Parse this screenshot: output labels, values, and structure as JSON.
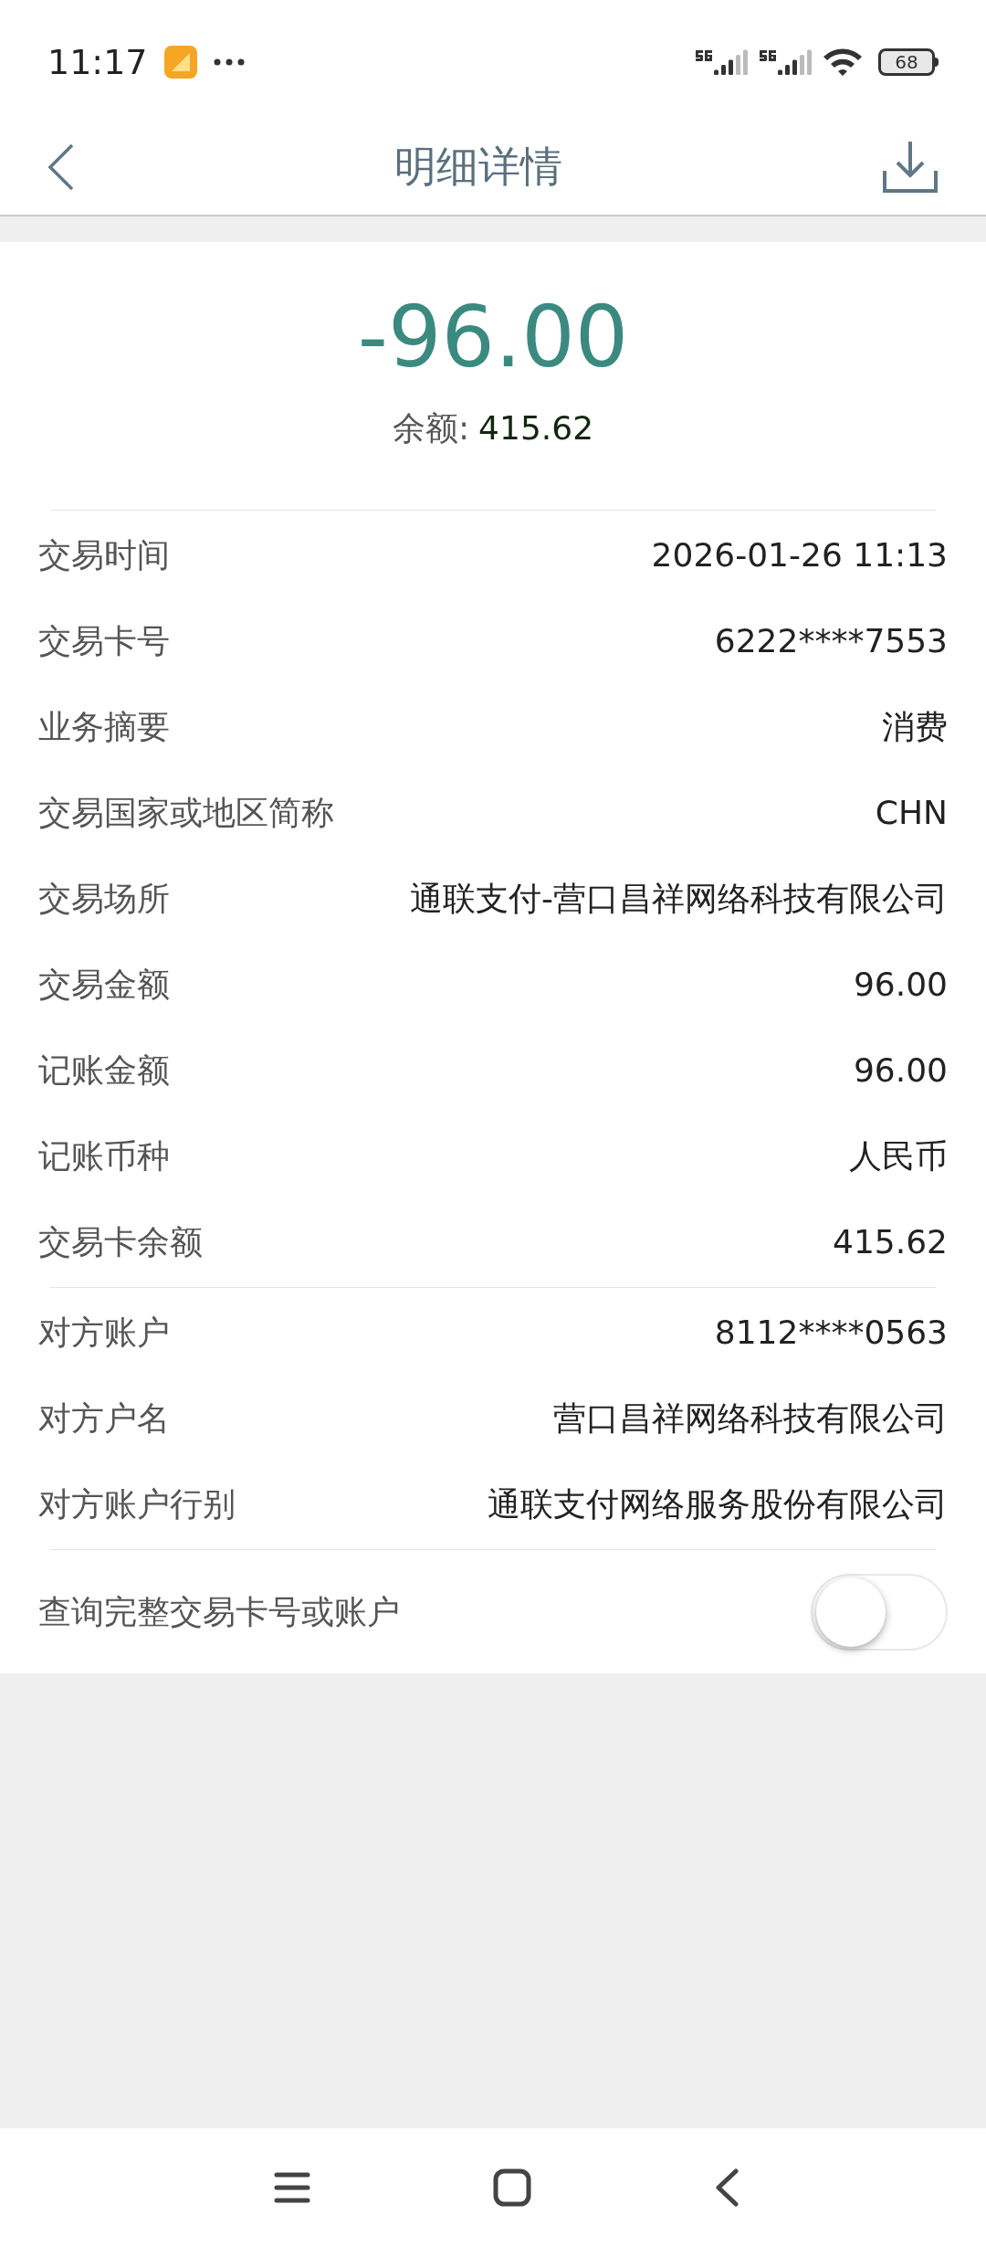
{
  "status_bar": {
    "time": "11:17",
    "battery": "68"
  },
  "header": {
    "title": "明细详情"
  },
  "summary": {
    "amount": "-96.00",
    "balance_label": "余额:",
    "balance": "415.62"
  },
  "sections": [
    {
      "rows": [
        {
          "label": "交易时间",
          "value": "2026-01-26 11:13"
        },
        {
          "label": "交易卡号",
          "value": "6222****7553"
        },
        {
          "label": "业务摘要",
          "value": "消费"
        },
        {
          "label": "交易国家或地区简称",
          "value": "CHN"
        },
        {
          "label": "交易场所",
          "value": "通联支付-营口昌祥网络科技有限公司"
        },
        {
          "label": "交易金额",
          "value": "96.00"
        },
        {
          "label": "记账金额",
          "value": "96.00"
        },
        {
          "label": "记账币种",
          "value": "人民币"
        },
        {
          "label": "交易卡余额",
          "value": "415.62"
        }
      ]
    },
    {
      "rows": [
        {
          "label": "对方账户",
          "value": "8112****0563"
        },
        {
          "label": "对方户名",
          "value": "营口昌祥网络科技有限公司"
        },
        {
          "label": "对方账户行别",
          "value": "通联支付网络服务股份有限公司"
        }
      ]
    }
  ],
  "toggle_row": {
    "label": "查询完整交易卡号或账户",
    "on": false
  }
}
